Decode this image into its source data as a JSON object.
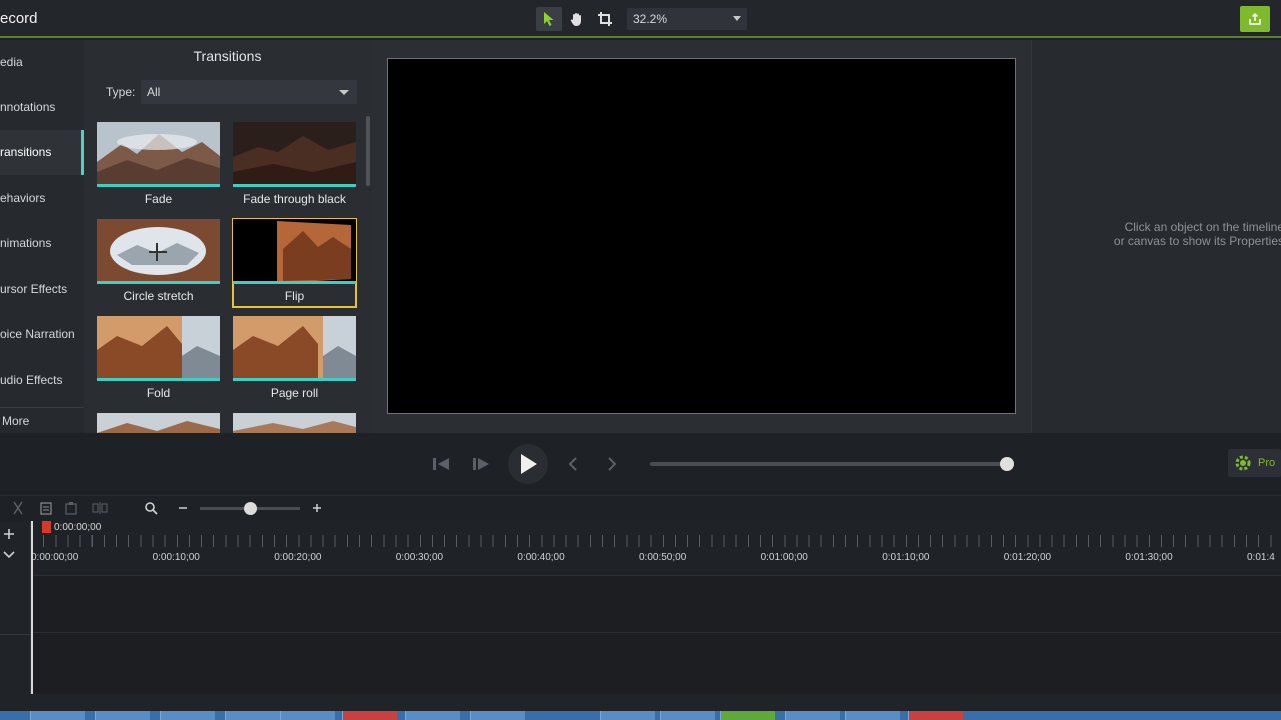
{
  "app": {
    "title": "ecord"
  },
  "toolbar": {
    "tools": [
      "pointer-tool",
      "pan-tool",
      "crop-tool"
    ],
    "zoom_value": "32.2%"
  },
  "sidebar": {
    "items": [
      {
        "label": "Media",
        "visible": "edia"
      },
      {
        "label": "Annotations",
        "visible": "nnotations"
      },
      {
        "label": "Transitions",
        "visible": "ransitions"
      },
      {
        "label": "Behaviors",
        "visible": "ehaviors"
      },
      {
        "label": "Animations",
        "visible": "nimations"
      },
      {
        "label": "Cursor Effects",
        "visible": "ursor Effects"
      },
      {
        "label": "Voice Narration",
        "visible": "oice Narration"
      },
      {
        "label": "Audio Effects",
        "visible": "udio Effects"
      }
    ],
    "more_label": "More"
  },
  "transitions": {
    "title": "Transitions",
    "type_label": "Type:",
    "type_value": "All",
    "tiles": [
      {
        "label": "Fade"
      },
      {
        "label": "Fade through black"
      },
      {
        "label": "Circle stretch"
      },
      {
        "label": "Flip"
      },
      {
        "label": "Fold"
      },
      {
        "label": "Page roll"
      }
    ]
  },
  "properties": {
    "hint_line1": "Click an object on the timeline",
    "hint_line2": "or canvas to show its Properties",
    "button_label": "Pro"
  },
  "timeline": {
    "playhead_time": "0:00:00;00",
    "labels": [
      "0:00:00;00",
      "0:00:10;00",
      "0:00:20;00",
      "0:00:30;00",
      "0:00:40;00",
      "0:00:50;00",
      "0:01:00;00",
      "0:01:10;00",
      "0:01:20;00",
      "0:01:30;00",
      "0:01:4"
    ]
  },
  "colors": {
    "accent_teal": "#3dd0c2",
    "accent_green": "#7fb92e",
    "selection_yellow": "#e8c23a",
    "playhead_red": "#d33a2c"
  }
}
